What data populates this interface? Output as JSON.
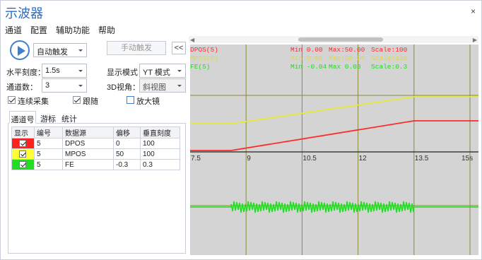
{
  "window": {
    "title": "示波器",
    "close_glyph": "×"
  },
  "menu": [
    "通道",
    "配置",
    "辅助功能",
    "帮助"
  ],
  "controls": {
    "trigger_mode": "自动触发",
    "manual_trigger_label": "手动触发",
    "collapse_label": "<<",
    "horizontal_scale_label": "水平刻度：",
    "horizontal_scale_value": "1.5s",
    "display_mode_label": "显示模式：",
    "display_mode_value": "YT 模式",
    "channel_count_label": "通道数：",
    "channel_count_value": "3",
    "view3d_label": "3D视角：",
    "view3d_value": "斜视图",
    "continuous_label": "连续采集",
    "continuous_checked": true,
    "follow_label": "跟随",
    "follow_checked": true,
    "magnifier_label": "放大镜",
    "magnifier_checked": false
  },
  "tabs": [
    "通道号",
    "游标",
    "统计"
  ],
  "table": {
    "headers": [
      "显示",
      "编号",
      "数据源",
      "偏移",
      "垂直刻度"
    ],
    "rows": [
      {
        "color": "#ff2020",
        "shown": true,
        "id": "5",
        "source": "DPOS",
        "offset": "0",
        "scale": "100"
      },
      {
        "color": "#ffff33",
        "shown": true,
        "id": "5",
        "source": "MPOS",
        "offset": "50",
        "scale": "100"
      },
      {
        "color": "#22dd22",
        "shown": true,
        "id": "5",
        "source": "FE",
        "offset": "-0.3",
        "scale": "0.3"
      }
    ]
  },
  "legend": [
    {
      "name": "DPOS(5)",
      "min": "Min 0.00",
      "max": "Max:50.00",
      "scale": "Scale:100",
      "color": "#ff2a2a"
    },
    {
      "name": "MPOS(5)",
      "min": "Min 0.00",
      "max": "Max:50.00",
      "scale": "Scale:100",
      "color": "#e8e83a"
    },
    {
      "name": "FE(5)",
      "min": "Min -0.04",
      "max": "Max 0.03",
      "scale": "Scale:0.3",
      "color": "#22dd22"
    }
  ],
  "chart_data": {
    "type": "line",
    "xlim": [
      7.5,
      15
    ],
    "x_ticks": [
      "7.5",
      "9",
      "10.5",
      "12",
      "13.5",
      "15s"
    ],
    "series": [
      {
        "name": "DPOS(5)",
        "color": "#ff2a2a",
        "x": [
          7.5,
          8.6,
          13.5,
          15
        ],
        "y": [
          0,
          0,
          50,
          50
        ]
      },
      {
        "name": "MPOS(5)",
        "color": "#e8e83a",
        "x": [
          7.5,
          8.6,
          13.5,
          15
        ],
        "y": [
          0,
          0,
          50,
          50
        ]
      },
      {
        "name": "FE(5)",
        "color": "#22dd22",
        "x": [
          7.5,
          8.6,
          13.5,
          15
        ],
        "y": [
          0,
          0.02,
          0.02,
          0
        ]
      }
    ]
  }
}
